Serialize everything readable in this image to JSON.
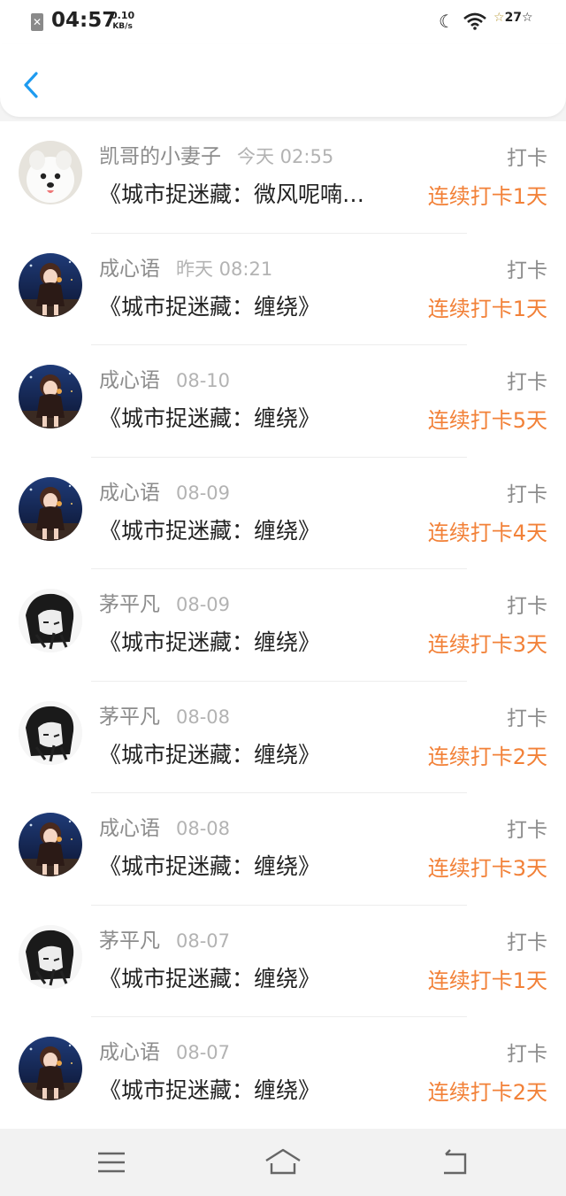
{
  "status_bar": {
    "time": "04:57",
    "net_speed_value": "0.10",
    "net_speed_unit": "KB/s",
    "battery": "27"
  },
  "header": {
    "back_icon": "chevron-left-icon",
    "accent_color": "#1e9bf0"
  },
  "colors": {
    "streak": "#f28138",
    "name": "#8c8c8c",
    "time": "#b3b3b3"
  },
  "checkins": [
    {
      "user": "凯哥的小妻子",
      "time": "今天 02:55",
      "action": "打卡",
      "title": "《城市捉迷藏：微风呢喃…",
      "streak": "连续打卡1天",
      "avatar": "white-dog"
    },
    {
      "user": "成心语",
      "time": "昨天 08:21",
      "action": "打卡",
      "title": "《城市捉迷藏：缠绕》",
      "streak": "连续打卡1天",
      "avatar": "anime-girl"
    },
    {
      "user": "成心语",
      "time": "08-10",
      "action": "打卡",
      "title": "《城市捉迷藏：缠绕》",
      "streak": "连续打卡5天",
      "avatar": "anime-girl"
    },
    {
      "user": "成心语",
      "time": "08-09",
      "action": "打卡",
      "title": "《城市捉迷藏：缠绕》",
      "streak": "连续打卡4天",
      "avatar": "anime-girl"
    },
    {
      "user": "茅平凡",
      "time": "08-09",
      "action": "打卡",
      "title": "《城市捉迷藏：缠绕》",
      "streak": "连续打卡3天",
      "avatar": "sketch-boy"
    },
    {
      "user": "茅平凡",
      "time": "08-08",
      "action": "打卡",
      "title": "《城市捉迷藏：缠绕》",
      "streak": "连续打卡2天",
      "avatar": "sketch-boy"
    },
    {
      "user": "成心语",
      "time": "08-08",
      "action": "打卡",
      "title": "《城市捉迷藏：缠绕》",
      "streak": "连续打卡3天",
      "avatar": "anime-girl"
    },
    {
      "user": "茅平凡",
      "time": "08-07",
      "action": "打卡",
      "title": "《城市捉迷藏：缠绕》",
      "streak": "连续打卡1天",
      "avatar": "sketch-boy"
    },
    {
      "user": "成心语",
      "time": "08-07",
      "action": "打卡",
      "title": "《城市捉迷藏：缠绕》",
      "streak": "连续打卡2天",
      "avatar": "anime-girl"
    }
  ],
  "nav_bar": {
    "menu_icon": "menu-icon",
    "home_icon": "home-icon",
    "back_icon": "back-arrow-icon"
  }
}
